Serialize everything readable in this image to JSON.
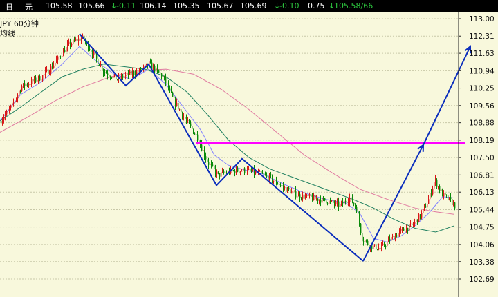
{
  "quote_bar": {
    "c1": "日",
    "c2": "元",
    "open": "105.58",
    "high": "105.66",
    "arrow1": "↓",
    "chg1": "-0.11",
    "v1": "106.14",
    "v2": "105.35",
    "v3": "105.67",
    "v4": "105.69",
    "arrow2": "↓",
    "chg2": "-0.10",
    "v5": "0.75",
    "arrow3": "↓",
    "v6": "105.58/66"
  },
  "symbol_label": "JPY   60分钟",
  "indicator_label": "均线",
  "colors": {
    "background": "#f8f8dc",
    "candle_up": "#d81818",
    "candle_down": "#0a8a0a",
    "ma_short": "#8080ff",
    "ma_mid": "#208060",
    "ma_long": "#e07aa0",
    "trend_lines": "#0a2dbc",
    "resistance": "#ff00ff"
  },
  "chart_data": {
    "type": "candlestick",
    "y_axis": {
      "ylim": [
        102.3,
        113.25
      ],
      "ticks": [
        113.0,
        112.31,
        111.63,
        110.94,
        110.25,
        109.56,
        108.88,
        108.19,
        107.5,
        106.81,
        106.13,
        105.44,
        104.75,
        104.06,
        103.38,
        102.69
      ],
      "tick_labels": [
        "113.00",
        "112.31",
        "111.63",
        "110.94",
        "110.25",
        "109.56",
        "108.88",
        "108.19",
        "107.50",
        "106.81",
        "106.13",
        "105.44",
        "104.75",
        "104.06",
        "103.38",
        "102.69"
      ],
      "gridlines": true
    },
    "price_path": [
      [
        0,
        108.95
      ],
      [
        18,
        109.6
      ],
      [
        30,
        110.3
      ],
      [
        45,
        110.5
      ],
      [
        60,
        110.7
      ],
      [
        75,
        111.1
      ],
      [
        88,
        111.6
      ],
      [
        100,
        112.0
      ],
      [
        118,
        112.25
      ],
      [
        130,
        111.8
      ],
      [
        150,
        110.9
      ],
      [
        170,
        110.6
      ],
      [
        185,
        110.8
      ],
      [
        200,
        110.9
      ],
      [
        215,
        111.2
      ],
      [
        235,
        110.7
      ],
      [
        250,
        109.8
      ],
      [
        270,
        108.9
      ],
      [
        285,
        108.3
      ],
      [
        300,
        107.3
      ],
      [
        315,
        106.8
      ],
      [
        330,
        106.95
      ],
      [
        350,
        107.0
      ],
      [
        370,
        106.9
      ],
      [
        390,
        106.7
      ],
      [
        410,
        106.3
      ],
      [
        430,
        106.0
      ],
      [
        450,
        105.9
      ],
      [
        470,
        105.8
      ],
      [
        490,
        105.6
      ],
      [
        505,
        105.9
      ],
      [
        515,
        105.5
      ],
      [
        523,
        104.3
      ],
      [
        535,
        104.0
      ],
      [
        550,
        103.9
      ],
      [
        565,
        104.3
      ],
      [
        580,
        104.6
      ],
      [
        595,
        104.8
      ],
      [
        610,
        105.3
      ],
      [
        620,
        105.9
      ],
      [
        628,
        106.6
      ],
      [
        640,
        106.0
      ],
      [
        650,
        105.8
      ],
      [
        657,
        105.6
      ]
    ],
    "moving_averages": [
      {
        "key": "ma_short",
        "path": [
          [
            0,
            108.95
          ],
          [
            30,
            110.0
          ],
          [
            60,
            110.5
          ],
          [
            90,
            111.2
          ],
          [
            115,
            111.9
          ],
          [
            140,
            111.3
          ],
          [
            165,
            110.8
          ],
          [
            190,
            110.6
          ],
          [
            215,
            111.0
          ],
          [
            240,
            110.4
          ],
          [
            265,
            109.5
          ],
          [
            290,
            108.6
          ],
          [
            310,
            107.6
          ],
          [
            330,
            107.2
          ],
          [
            355,
            107.0
          ],
          [
            380,
            106.85
          ],
          [
            410,
            106.45
          ],
          [
            440,
            106.1
          ],
          [
            470,
            105.85
          ],
          [
            500,
            105.7
          ],
          [
            520,
            105.3
          ],
          [
            540,
            104.3
          ],
          [
            560,
            104.15
          ],
          [
            580,
            104.4
          ],
          [
            600,
            104.8
          ],
          [
            620,
            105.3
          ],
          [
            640,
            105.95
          ],
          [
            657,
            105.9
          ]
        ]
      },
      {
        "key": "ma_mid",
        "path": [
          [
            0,
            108.95
          ],
          [
            30,
            109.5
          ],
          [
            60,
            110.1
          ],
          [
            90,
            110.7
          ],
          [
            120,
            111.0
          ],
          [
            150,
            111.2
          ],
          [
            180,
            111.1
          ],
          [
            210,
            111.0
          ],
          [
            240,
            110.7
          ],
          [
            270,
            110.1
          ],
          [
            300,
            109.2
          ],
          [
            330,
            108.2
          ],
          [
            360,
            107.5
          ],
          [
            390,
            107.05
          ],
          [
            420,
            106.75
          ],
          [
            450,
            106.45
          ],
          [
            480,
            106.15
          ],
          [
            510,
            105.85
          ],
          [
            540,
            105.5
          ],
          [
            570,
            105.05
          ],
          [
            600,
            104.7
          ],
          [
            630,
            104.55
          ],
          [
            657,
            104.8
          ]
        ]
      },
      {
        "key": "ma_long",
        "path": [
          [
            0,
            108.5
          ],
          [
            40,
            109.1
          ],
          [
            80,
            109.75
          ],
          [
            120,
            110.3
          ],
          [
            160,
            110.7
          ],
          [
            200,
            110.95
          ],
          [
            240,
            111.0
          ],
          [
            280,
            110.8
          ],
          [
            320,
            110.2
          ],
          [
            360,
            109.4
          ],
          [
            400,
            108.5
          ],
          [
            440,
            107.6
          ],
          [
            480,
            106.9
          ],
          [
            520,
            106.25
          ],
          [
            560,
            105.85
          ],
          [
            600,
            105.5
          ],
          [
            630,
            105.35
          ],
          [
            657,
            105.25
          ]
        ]
      }
    ],
    "annotations": {
      "zigzag_lines": [
        {
          "points": [
            [
              115,
              112.4
            ],
            [
              182,
              110.35
            ],
            [
              215,
              111.2
            ],
            [
              313,
              106.4
            ],
            [
              350,
              107.45
            ],
            [
              525,
              103.4
            ]
          ]
        },
        {
          "points": [
            [
              525,
              103.4
            ],
            [
              612,
              108.0
            ]
          ],
          "arrow_end": true
        },
        {
          "points": [
            [
              612,
              108.0
            ],
            [
              680,
              111.9
            ]
          ],
          "arrow_end": true
        }
      ],
      "resistance_line": {
        "y": 108.07,
        "x_start": 283,
        "x_end": 672
      }
    }
  }
}
